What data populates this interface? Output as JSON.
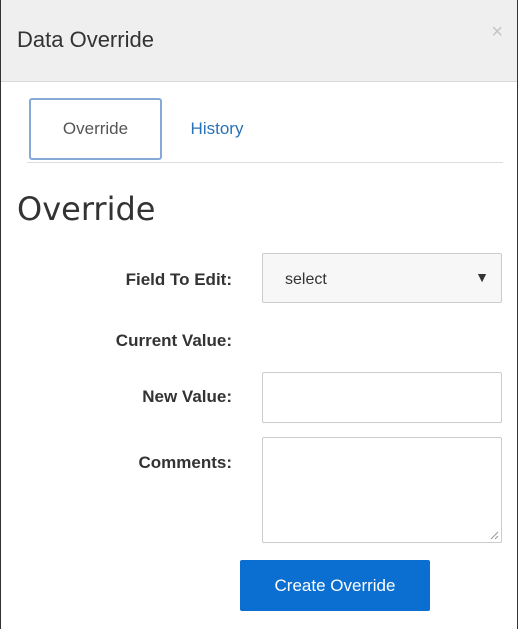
{
  "dialog": {
    "title": "Data Override",
    "close_glyph": "×"
  },
  "tabs": [
    {
      "label": "Override",
      "active": true
    },
    {
      "label": "History",
      "active": false
    }
  ],
  "section": {
    "heading": "Override"
  },
  "form": {
    "field_to_edit": {
      "label": "Field To Edit:",
      "value": "select",
      "arrow": "▼"
    },
    "current_value": {
      "label": "Current Value:",
      "value": ""
    },
    "new_value": {
      "label": "New Value:",
      "value": ""
    },
    "comments": {
      "label": "Comments:",
      "value": ""
    }
  },
  "actions": {
    "create_label": "Create Override"
  },
  "colors": {
    "header_bg": "#efefef",
    "tab_active_border": "#86a9d8",
    "link": "#2a72b8",
    "primary_button": "#0a6fd1"
  }
}
